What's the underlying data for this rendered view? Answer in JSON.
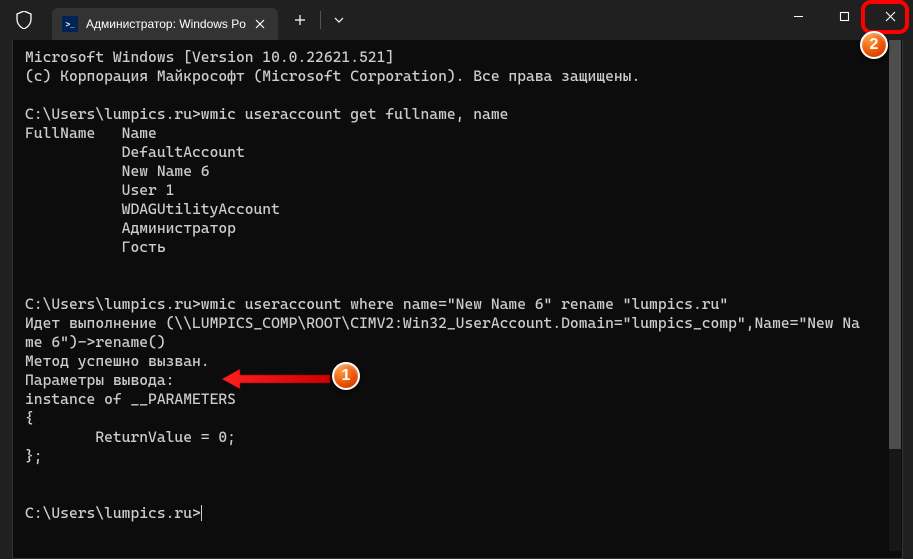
{
  "titlebar": {
    "tab_title": "Администратор: Windows Po",
    "powershell_glyph": ">_"
  },
  "terminal": {
    "line1": "Microsoft Windows [Version 10.0.22621.521]",
    "line2": "(c) Корпорация Майкрософт (Microsoft Corporation). Все права защищены.",
    "blank1": "",
    "prompt1": "C:\\Users\\lumpics.ru>wmic useraccount get fullname, name",
    "header": "FullName   Name",
    "acc1": "           DefaultAccount",
    "acc2": "           New Name 6",
    "acc3": "           User 1",
    "acc4": "           WDAGUtilityAccount",
    "acc5": "           Администратор",
    "acc6": "           Гость",
    "blank2": "",
    "blank3": "",
    "prompt2": "C:\\Users\\lumpics.ru>wmic useraccount where name=\"New Name 6\" rename \"lumpics.ru\"",
    "exec1": "Идет выполнение (\\\\LUMPICS_COMP\\ROOT\\CIMV2:Win32_UserAccount.Domain=\"lumpics_comp\",Name=\"New Na",
    "exec2": "me 6\")->rename()",
    "success": "Метод успешно вызван.",
    "params": "Параметры вывода:",
    "inst": "instance of __PARAMETERS",
    "brace1": "{",
    "retval": "        ReturnValue = 0;",
    "brace2": "};",
    "blank4": "",
    "blank5": "",
    "prompt3": "C:\\Users\\lumpics.ru>"
  },
  "badges": {
    "b1": "1",
    "b2": "2"
  }
}
